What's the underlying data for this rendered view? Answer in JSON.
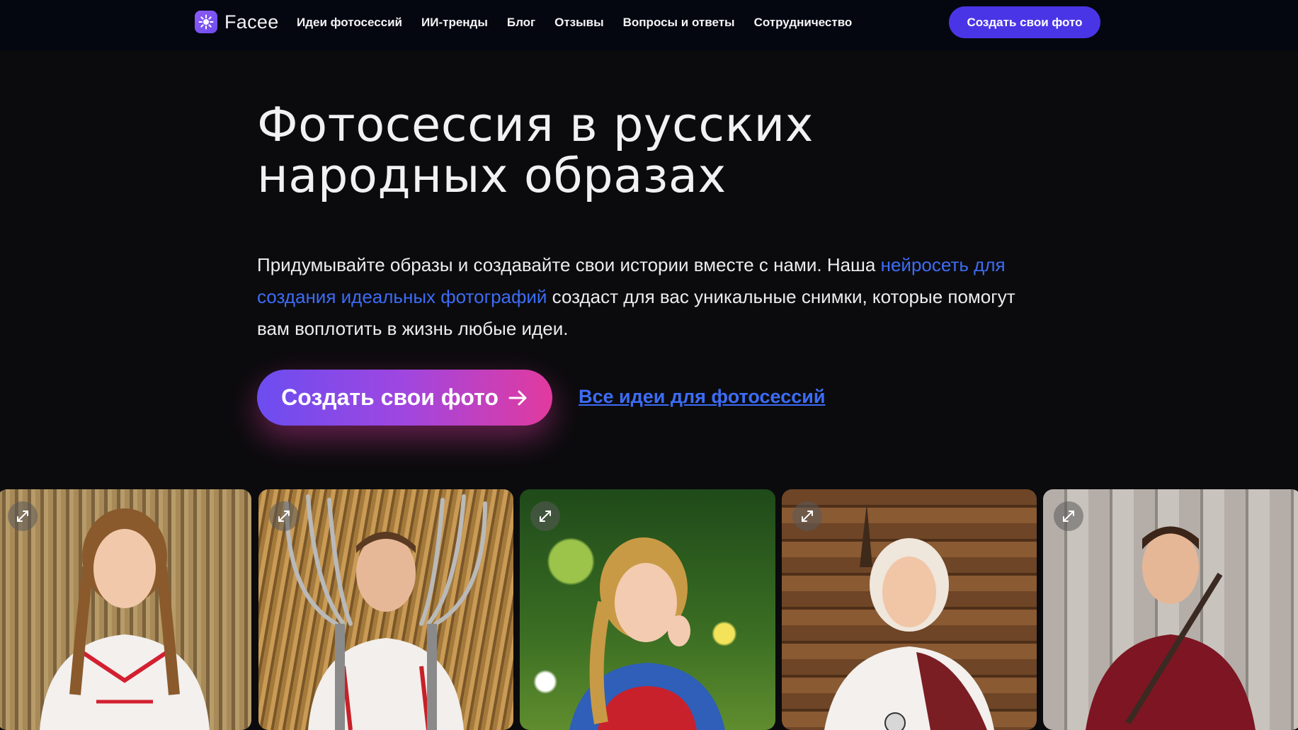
{
  "header": {
    "logo_text": "Facee",
    "nav": [
      {
        "label": "Идеи фотосессий"
      },
      {
        "label": "ИИ-тренды"
      },
      {
        "label": "Блог"
      },
      {
        "label": "Отзывы"
      },
      {
        "label": "Вопросы и ответы"
      },
      {
        "label": "Сотрудничество"
      }
    ],
    "cta_label": "Создать свои фото"
  },
  "hero": {
    "title_line1": "Фотосессия в русских",
    "title_line2": "народных образах",
    "text_before": "Придумывайте образы и создавайте свои истории вместе с нами. Наша ",
    "text_link": "нейросеть для создания идеальных фотографий",
    "text_after": " создаст для вас уникальные снимки, которые помогут вам воплотить в жизнь любые идеи.",
    "cta_label": "Создать свои фото",
    "ideas_link": "Все идеи для фотосессий"
  },
  "gallery": {
    "items": [
      {
        "icon": "expand-icon"
      },
      {
        "icon": "expand-icon"
      },
      {
        "icon": "expand-icon"
      },
      {
        "icon": "expand-icon"
      },
      {
        "icon": "expand-icon"
      }
    ]
  },
  "colors": {
    "accent": "#4a35e6",
    "link": "#3d6cf5",
    "gradient_start": "#6c4df0",
    "gradient_end": "#e23a9e",
    "background": "#0b0b0d"
  }
}
